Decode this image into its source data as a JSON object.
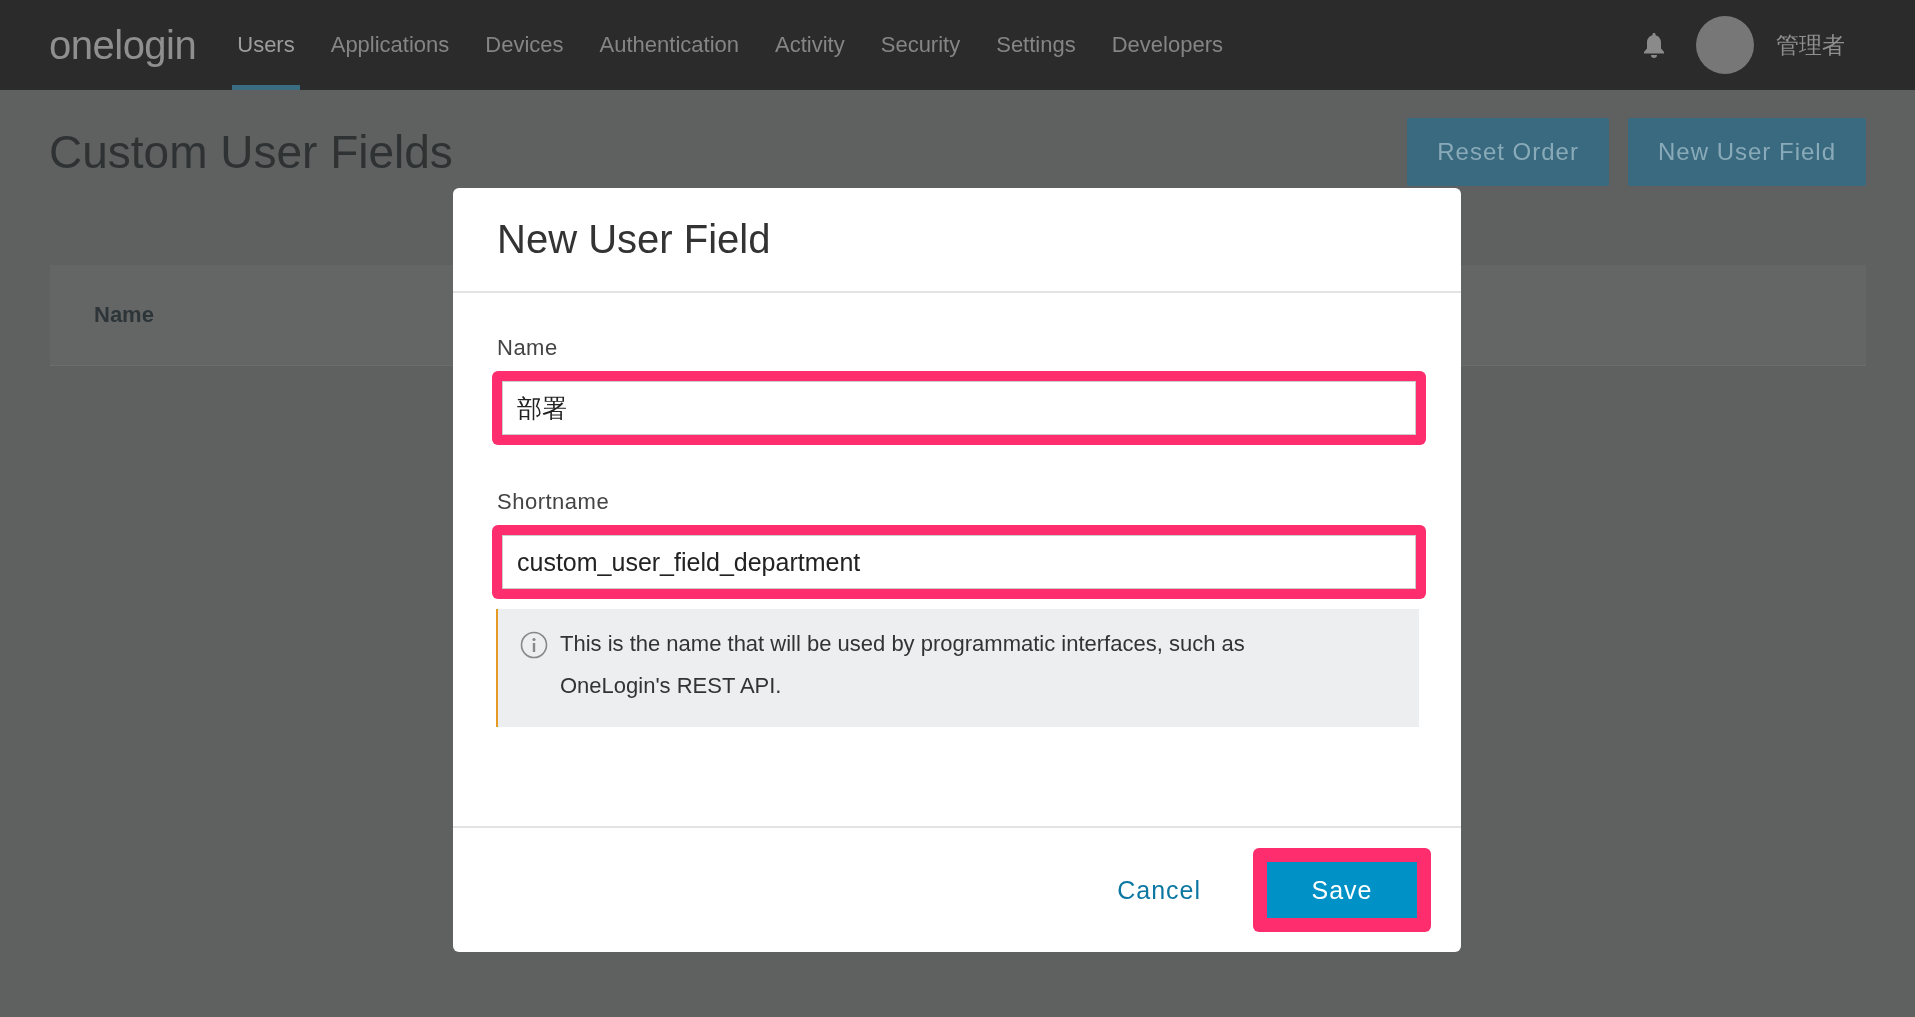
{
  "nav": {
    "logo": "onelogin",
    "items": [
      {
        "label": "Users",
        "selected": true
      },
      {
        "label": "Applications",
        "selected": false
      },
      {
        "label": "Devices",
        "selected": false
      },
      {
        "label": "Authentication",
        "selected": false
      },
      {
        "label": "Activity",
        "selected": false
      },
      {
        "label": "Security",
        "selected": false
      },
      {
        "label": "Settings",
        "selected": false
      },
      {
        "label": "Developers",
        "selected": false
      }
    ],
    "user": "管理者"
  },
  "page": {
    "title": "Custom User Fields",
    "buttons": [
      "Reset Order",
      "New User Field"
    ],
    "table": {
      "columns": [
        "Name"
      ]
    }
  },
  "dialog": {
    "title": "New User Field",
    "fields": [
      {
        "label": "Name",
        "value": "部署",
        "highlighted": true
      },
      {
        "label": "Shortname",
        "value": "custom_user_field_department",
        "highlighted": true
      }
    ],
    "info": "This is the name that will be used by programmatic interfaces, such as OneLogin's REST API.",
    "cancel": "Cancel",
    "save": {
      "label": "Save",
      "highlighted": true
    }
  }
}
